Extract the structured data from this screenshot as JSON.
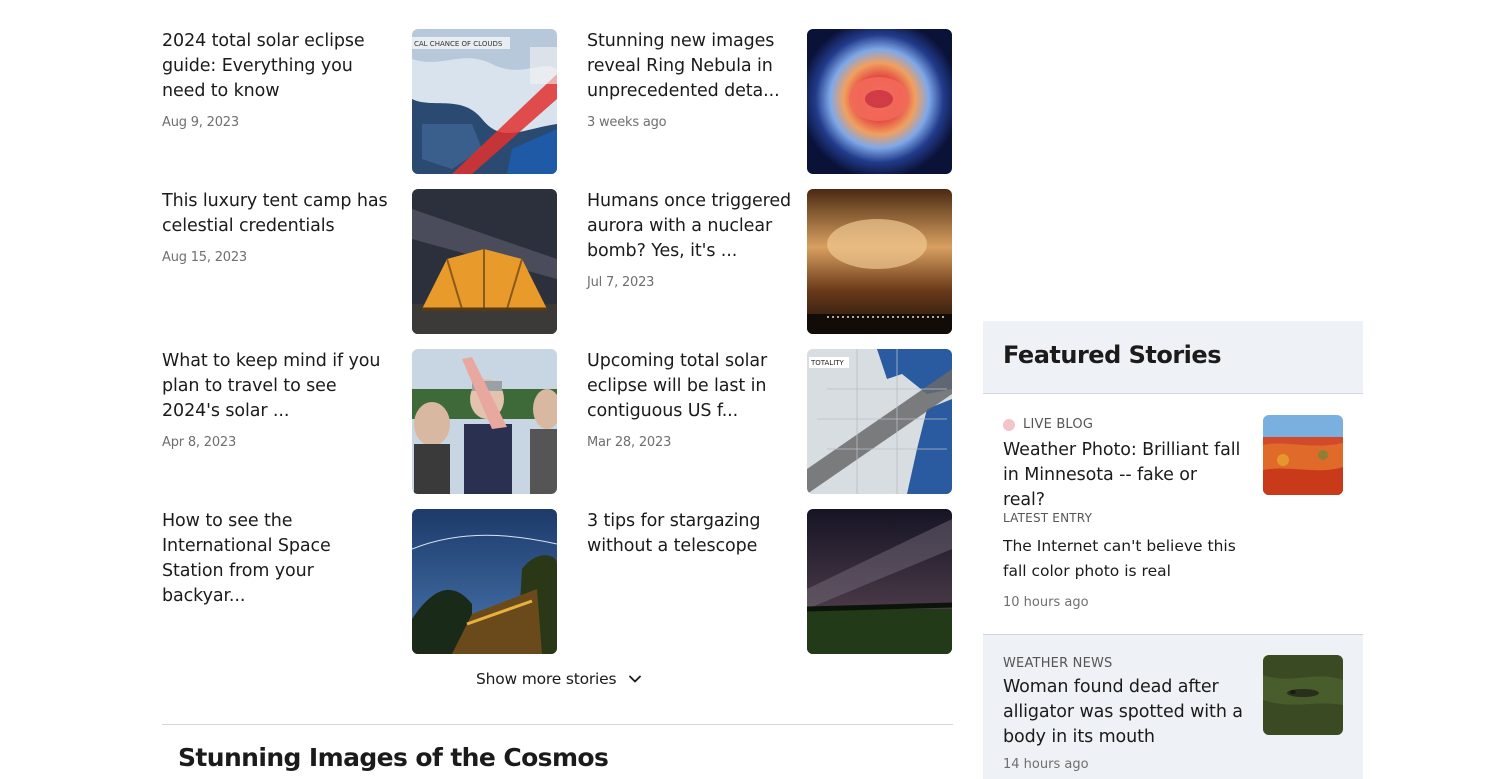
{
  "stories": [
    {
      "headline": "2024 total solar eclipse guide: Everything you need to know",
      "date": "Aug 9, 2023",
      "image": "eclipse-cloud-map"
    },
    {
      "headline": "Stunning new images reveal Ring Nebula in unprecedented deta...",
      "date": "3 weeks ago",
      "image": "ring-nebula"
    },
    {
      "headline": "This luxury tent camp has celestial credentials",
      "date": "Aug 15, 2023",
      "image": "tent-camp-milky-way"
    },
    {
      "headline": "Humans once triggered aurora with a nuclear bomb? Yes, it's ...",
      "date": "Jul 7, 2023",
      "image": "nuclear-aurora-sky"
    },
    {
      "headline": "What to keep mind if you plan to travel to see 2024's solar ...",
      "date": "Apr 8, 2023",
      "image": "eclipse-viewers"
    },
    {
      "headline": "Upcoming total solar eclipse will be last in contiguous US f...",
      "date": "Mar 28, 2023",
      "image": "totality-path-map"
    },
    {
      "headline": "How to see the International Space Station from your backyar...",
      "date": "",
      "image": "iss-night-sky"
    },
    {
      "headline": "3 tips for stargazing without a telescope",
      "date": "",
      "image": "milky-way-field"
    }
  ],
  "map_labels": {
    "clouds": "CAL CHANCE OF CLOUDS",
    "totality": "TOTALITY"
  },
  "show_more": {
    "label": "Show more stories"
  },
  "section": {
    "title": "Stunning Images of the Cosmos"
  },
  "featured": {
    "title": "Featured Stories",
    "live": {
      "kicker": "LIVE BLOG",
      "title": "Weather Photo: Brilliant fall in Minnesota -- fake or real?",
      "entry_label": "LATEST ENTRY",
      "entry_text": "The Internet can't believe this fall color photo is real",
      "time": "10 hours ago"
    },
    "news": {
      "kicker": "WEATHER NEWS",
      "title": "Woman found dead after alligator was spotted with a body in its mouth",
      "time": "14 hours ago"
    }
  },
  "colors": {
    "live_dot": "#f3c4c8",
    "featured_bg": "#eef1f5",
    "date_gray": "#6f6f6f"
  }
}
